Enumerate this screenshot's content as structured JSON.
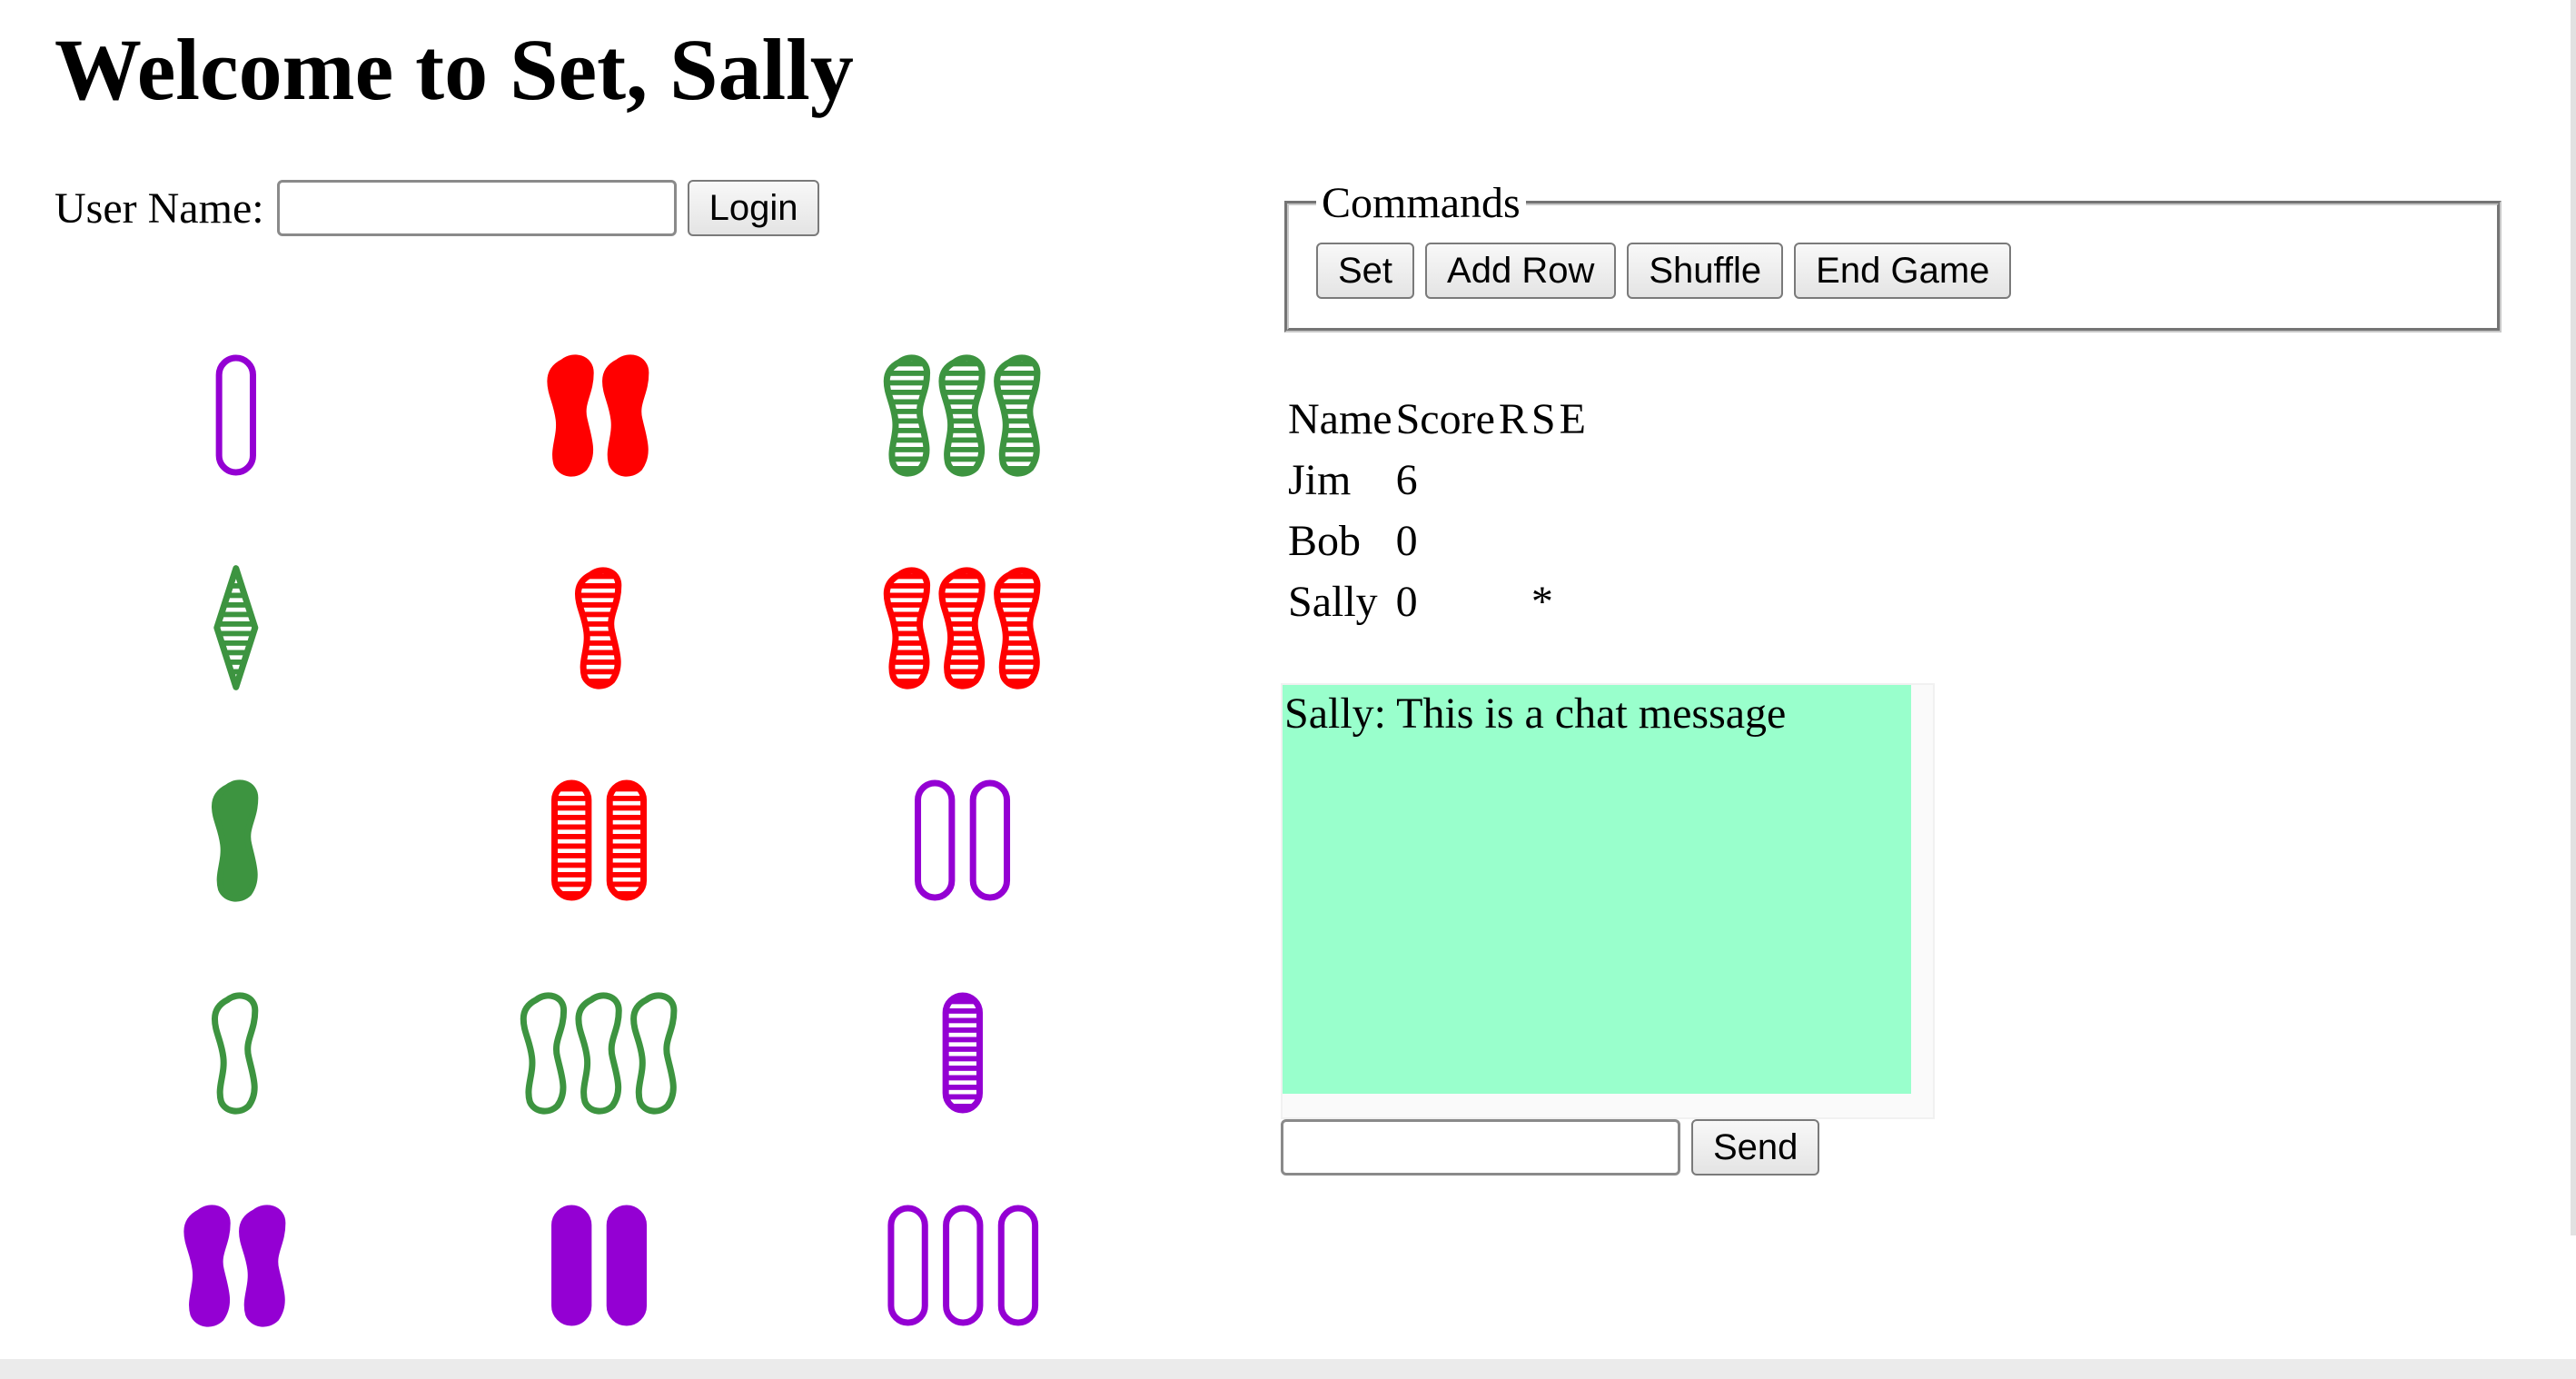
{
  "header": {
    "title": "Welcome to Set, Sally"
  },
  "login": {
    "label": "User Name:",
    "input_value": "",
    "button_label": "Login"
  },
  "commands": {
    "legend": "Commands",
    "buttons": [
      "Set",
      "Add Row",
      "Shuffle",
      "End Game"
    ]
  },
  "scoreboard": {
    "headers": [
      "Name",
      "Score",
      "R",
      "S",
      "E"
    ],
    "rows": [
      {
        "name": "Jim",
        "score": "6",
        "r": "",
        "s": "",
        "e": ""
      },
      {
        "name": "Bob",
        "score": "0",
        "r": "",
        "s": "",
        "e": ""
      },
      {
        "name": "Sally",
        "score": "0",
        "r": "",
        "s": "*",
        "e": ""
      }
    ]
  },
  "chat": {
    "messages": [
      "Sally: This is a chat message"
    ],
    "input_value": "",
    "send_label": "Send",
    "background": "#99ffcc"
  },
  "colors": {
    "purple": "#9400d3",
    "red": "#ff0000",
    "green": "#3d9440"
  },
  "cards": [
    {
      "count": 1,
      "color": "purple",
      "shape": "oval",
      "shading": "empty"
    },
    {
      "count": 2,
      "color": "red",
      "shape": "squiggle",
      "shading": "solid"
    },
    {
      "count": 3,
      "color": "green",
      "shape": "squiggle",
      "shading": "striped"
    },
    {
      "count": 1,
      "color": "green",
      "shape": "diamond",
      "shading": "striped"
    },
    {
      "count": 1,
      "color": "red",
      "shape": "squiggle",
      "shading": "striped"
    },
    {
      "count": 3,
      "color": "red",
      "shape": "squiggle",
      "shading": "striped"
    },
    {
      "count": 1,
      "color": "green",
      "shape": "squiggle",
      "shading": "solid"
    },
    {
      "count": 2,
      "color": "red",
      "shape": "oval",
      "shading": "striped"
    },
    {
      "count": 2,
      "color": "purple",
      "shape": "oval",
      "shading": "empty"
    },
    {
      "count": 1,
      "color": "green",
      "shape": "squiggle",
      "shading": "empty"
    },
    {
      "count": 3,
      "color": "green",
      "shape": "squiggle",
      "shading": "empty"
    },
    {
      "count": 1,
      "color": "purple",
      "shape": "oval",
      "shading": "striped"
    },
    {
      "count": 2,
      "color": "purple",
      "shape": "squiggle",
      "shading": "solid"
    },
    {
      "count": 2,
      "color": "purple",
      "shape": "oval",
      "shading": "solid"
    },
    {
      "count": 3,
      "color": "purple",
      "shape": "oval",
      "shading": "empty"
    }
  ]
}
